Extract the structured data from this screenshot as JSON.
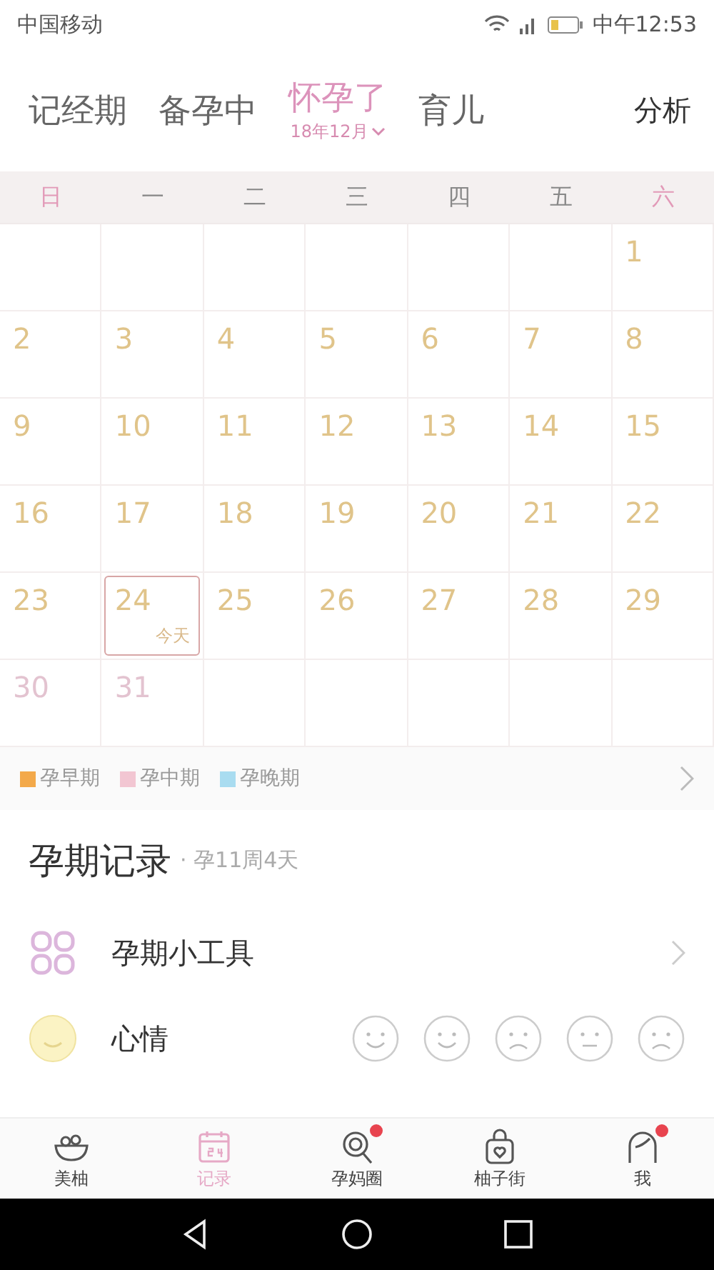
{
  "status_bar": {
    "carrier": "中国移动",
    "time": "中午12:53"
  },
  "tabs": [
    {
      "label": "记经期",
      "selected": false
    },
    {
      "label": "备孕中",
      "selected": false
    },
    {
      "label": "怀孕了",
      "selected": true,
      "subtitle": "18年12月"
    },
    {
      "label": "育儿",
      "selected": false
    }
  ],
  "analysis_button": "分析",
  "weekdays": [
    {
      "label": "日",
      "weekend": true
    },
    {
      "label": "一",
      "weekend": false
    },
    {
      "label": "二",
      "weekend": false
    },
    {
      "label": "三",
      "weekend": false
    },
    {
      "label": "四",
      "weekend": false
    },
    {
      "label": "五",
      "weekend": false
    },
    {
      "label": "六",
      "weekend": true
    }
  ],
  "calendar": {
    "days": [
      {
        "day": "1",
        "color": "#e0c48a"
      },
      {
        "day": "2",
        "color": "#e0c48a"
      },
      {
        "day": "3",
        "color": "#e0c48a"
      },
      {
        "day": "4",
        "color": "#e0c48a"
      },
      {
        "day": "5",
        "color": "#e0c48a"
      },
      {
        "day": "6",
        "color": "#e0c48a"
      },
      {
        "day": "7",
        "color": "#e0c48a"
      },
      {
        "day": "8",
        "color": "#e0c48a"
      },
      {
        "day": "9",
        "color": "#e0c48a"
      },
      {
        "day": "10",
        "color": "#e0c48a"
      },
      {
        "day": "11",
        "color": "#e0c48a"
      },
      {
        "day": "12",
        "color": "#e0c48a"
      },
      {
        "day": "13",
        "color": "#e0c48a"
      },
      {
        "day": "14",
        "color": "#e0c48a"
      },
      {
        "day": "15",
        "color": "#e0c48a"
      },
      {
        "day": "16",
        "color": "#e0c48a"
      },
      {
        "day": "17",
        "color": "#e0c48a"
      },
      {
        "day": "18",
        "color": "#e0c48a"
      },
      {
        "day": "19",
        "color": "#e0c48a"
      },
      {
        "day": "20",
        "color": "#e0c48a"
      },
      {
        "day": "21",
        "color": "#e0c48a"
      },
      {
        "day": "22",
        "color": "#e0c48a"
      },
      {
        "day": "23",
        "color": "#e0c48a"
      },
      {
        "day": "24",
        "color": "#e0c48a",
        "today": true,
        "note": "今天"
      },
      {
        "day": "25",
        "color": "#e0c48a"
      },
      {
        "day": "26",
        "color": "#e0c48a"
      },
      {
        "day": "27",
        "color": "#e0c48a"
      },
      {
        "day": "28",
        "color": "#e0c48a"
      },
      {
        "day": "29",
        "color": "#e0c48a"
      },
      {
        "day": "30",
        "color": "#e3c3d0"
      },
      {
        "day": "31",
        "color": "#e3c3d0"
      }
    ]
  },
  "legend": [
    {
      "label": "孕早期",
      "color": "#f3a94a"
    },
    {
      "label": "孕中期",
      "color": "#f2c6d2"
    },
    {
      "label": "孕晚期",
      "color": "#a9dcf0"
    }
  ],
  "record": {
    "title": "孕期记录",
    "subtitle": "· 孕11周4天"
  },
  "rows": [
    {
      "kind": "tools",
      "label": "孕期小工具"
    },
    {
      "kind": "mood",
      "label": "心情"
    }
  ],
  "bottom_tabs": [
    {
      "label": "美柚",
      "selected": false,
      "badge": false
    },
    {
      "label": "记录",
      "selected": true,
      "badge": false
    },
    {
      "label": "孕妈圈",
      "selected": false,
      "badge": true
    },
    {
      "label": "柚子街",
      "selected": false,
      "badge": false
    },
    {
      "label": "我",
      "selected": false,
      "badge": true
    }
  ]
}
